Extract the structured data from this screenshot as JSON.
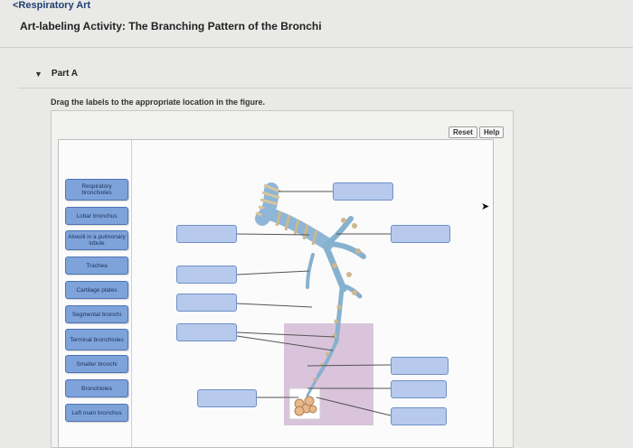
{
  "breadcrumb": "<Respiratory Art",
  "activity_title": "Art-labeling Activity: The Branching Pattern of the Bronchi",
  "part_label": "Part A",
  "instructions": "Drag the labels to the appropriate location in the figure.",
  "buttons": {
    "reset": "Reset",
    "help": "Help"
  },
  "labels": [
    "Respiratory bronchioles",
    "Lobar bronchus",
    "Alveoli in a pulmonary lobule",
    "Trachea",
    "Cartilage plates",
    "Segmental bronchi",
    "Terminal bronchioles",
    "Smaller bronchi",
    "Bronchioles",
    "Left main bronchus"
  ],
  "colors": {
    "label_fill": "#7ea3db",
    "drop_target_fill": "#b7caed",
    "lobule_highlight": "#d9c4dc",
    "airway_blue": "#7fb0cf",
    "cartilage_tan": "#c9b58e"
  }
}
